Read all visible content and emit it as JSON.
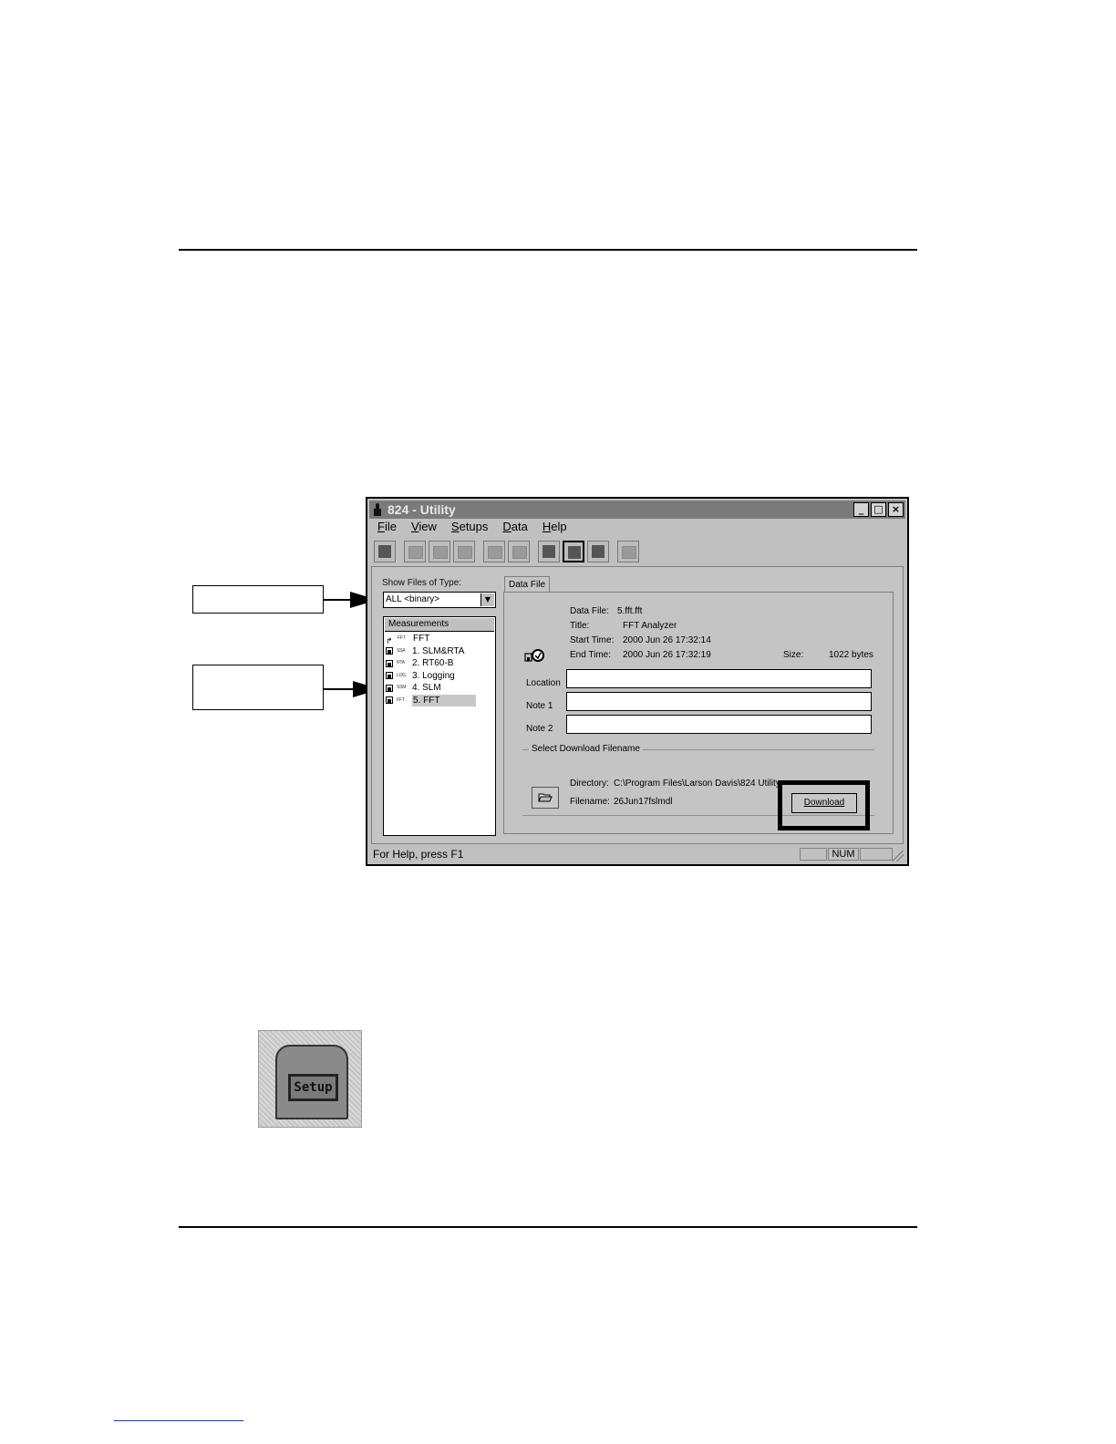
{
  "window": {
    "title": "824 - Utility",
    "controls": [
      "_",
      "□",
      "×"
    ]
  },
  "menu": [
    "File",
    "View",
    "Setups",
    "Data",
    "Help"
  ],
  "left": {
    "show_files_label": "Show Files of Type:",
    "combo_value": "ALL <binary>",
    "list_header": "Measurements",
    "items": [
      {
        "tag": "FFT",
        "label": "FFT"
      },
      {
        "tag": "SSA",
        "label": "1. SLM&RTA"
      },
      {
        "tag": "RTA",
        "label": "2. RT60-B"
      },
      {
        "tag": "LOG",
        "label": "3. Logging"
      },
      {
        "tag": "SSM",
        "label": "4. SLM"
      },
      {
        "tag": "FFT",
        "label": "5. FFT"
      }
    ]
  },
  "tab": "Data File",
  "info": {
    "data_file_label": "Data File:",
    "data_file_value": "5.fft.fft",
    "title_label": "Title:",
    "title_value": "FFT Analyzer",
    "start_label": "Start Time:",
    "start_value": "2000 Jun 26 17:32:14",
    "end_label": "End Time:",
    "end_value": "2000 Jun 26 17:32:19",
    "size_label": "Size:",
    "size_value": "1022 bytes"
  },
  "fields": {
    "location_label": "Location",
    "note1_label": "Note 1",
    "note2_label": "Note 2"
  },
  "download": {
    "group_label": "Select Download Filename",
    "directory_label": "Directory:",
    "directory_value": "C:\\Program Files\\Larson Davis\\824 Utility",
    "filename_label": "Filename:",
    "filename_value": "26Jun17fslmdl",
    "button_label": "Download"
  },
  "status": {
    "help_text": "For Help, press F1",
    "num": "NUM"
  },
  "setup_icon_label": "Setup"
}
